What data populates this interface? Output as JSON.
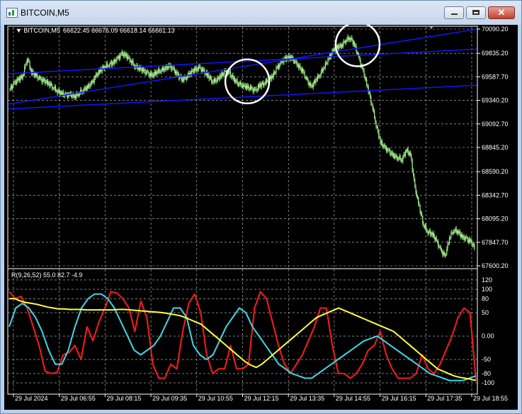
{
  "window": {
    "title": "BITCOIN,M5",
    "minimize_icon": "minimize-icon",
    "maximize_icon": "maximize-icon",
    "close_icon": "close-icon",
    "close_glyph": "✕"
  },
  "colors": {
    "background": "#000000",
    "grid": "#c8c8c8",
    "candles": "#a6f08c",
    "channel": "#1414ff",
    "highlight": "#ffffff",
    "osc_red": "#ff1a1a",
    "osc_cyan": "#3cd8e8",
    "osc_yellow": "#ffff33",
    "text": "#ffffff"
  },
  "chart_data": [
    {
      "type": "candlestick",
      "symbol_label": "BITCOIN,M5",
      "ohlc_label": "66622.45 66676.09 66618.14 66661.13",
      "y_ticks": [
        "70090.20",
        "69835.20",
        "69587.70",
        "69340.20",
        "69092.70",
        "68845.20",
        "68590.20",
        "68342.70",
        "68095.20",
        "67847.70",
        "67600.20"
      ],
      "ylim": [
        67600.2,
        70090.2
      ],
      "x_ticks": [
        "29 Jul 2024",
        "29 Jul 06:55",
        "29 Jul 08:15",
        "29 Jul 09:35",
        "29 Jul 10:55",
        "29 Jul 12:15",
        "29 Jul 13:35",
        "29 Jul 14:55",
        "29 Jul 16:15",
        "29 Jul 17:35",
        "29 Jul 18:55"
      ],
      "series": [
        {
          "values": [
            69460,
            69520,
            69560,
            69600,
            69790,
            69640,
            69600,
            69560,
            69540,
            69520,
            69480,
            69440,
            69410,
            69390,
            69400,
            69380,
            69420,
            69450,
            69480,
            69520,
            69600,
            69660,
            69700,
            69720,
            69740,
            69780,
            69830,
            69810,
            69760,
            69700,
            69680,
            69650,
            69620,
            69600,
            69640,
            69660,
            69680,
            69700,
            69660,
            69600,
            69560,
            69590,
            69640,
            69660,
            69680,
            69640,
            69600,
            69540,
            69560,
            69600,
            69640,
            69620,
            69560,
            69520,
            69500,
            69480,
            69460,
            69440,
            69500,
            69520,
            69560,
            69600,
            69680,
            69740,
            69780,
            69800,
            69760,
            69700,
            69640,
            69540,
            69480,
            69560,
            69620,
            69700,
            69780,
            69860,
            69900,
            69920,
            69980,
            70000,
            69920,
            69780,
            69640,
            69480,
            69300,
            69080,
            68900,
            68840,
            68800,
            68760,
            68740,
            68720,
            68820,
            68760,
            68420,
            68220,
            68030,
            67960,
            67940,
            67860,
            67760,
            67700,
            67900,
            67980,
            67960,
            67900,
            67880,
            67850,
            67780
          ]
        }
      ],
      "channel_lines": [
        {
          "from": [
            0,
            69300
          ],
          "to": [
            1,
            70090
          ]
        },
        {
          "from": [
            0,
            69620
          ],
          "to": [
            1,
            69880
          ]
        },
        {
          "from": [
            0,
            69250
          ],
          "to": [
            1,
            69500
          ]
        }
      ],
      "highlight_circles": [
        {
          "t": 0.51,
          "value": 69540
        },
        {
          "t": 0.745,
          "value": 69930
        }
      ]
    },
    {
      "type": "line",
      "label": "R(9,26,52) 55.0 82.7 -4.9",
      "y_ticks": [
        "120",
        "100",
        "80",
        "50",
        "0.00",
        "-50",
        "-80",
        "-100"
      ],
      "y_tick_values": [
        120,
        100,
        80,
        50,
        0,
        -50,
        -80,
        -100
      ],
      "ylim": [
        -115,
        135
      ],
      "series": [
        {
          "color": "osc_red",
          "values": [
            95,
            80,
            85,
            60,
            20,
            -20,
            -75,
            -80,
            -78,
            -40,
            -35,
            -20,
            -50,
            20,
            -10,
            30,
            60,
            95,
            92,
            80,
            60,
            10,
            75,
            40,
            -60,
            -90,
            -90,
            -60,
            -70,
            10,
            70,
            90,
            50,
            -40,
            -80,
            -70,
            -70,
            -20,
            -70,
            -70,
            -60,
            60,
            95,
            80,
            30,
            -20,
            -60,
            -80,
            -60,
            -40,
            -10,
            20,
            60,
            60,
            -20,
            -80,
            -80,
            -90,
            -80,
            -60,
            -30,
            -20,
            10,
            -40,
            -70,
            -90,
            -90,
            -90,
            -80,
            -40,
            -70,
            -80,
            -60,
            -30,
            0,
            40,
            60,
            50,
            -95
          ]
        },
        {
          "color": "osc_cyan",
          "values": [
            20,
            60,
            70,
            60,
            40,
            10,
            -30,
            -60,
            -60,
            -30,
            20,
            60,
            80,
            90,
            90,
            80,
            60,
            30,
            0,
            -30,
            -40,
            -30,
            -20,
            0,
            30,
            60,
            60,
            40,
            -20,
            -40,
            -50,
            -40,
            -10,
            20,
            40,
            60,
            50,
            20,
            0,
            -20,
            -40,
            -60,
            -70,
            -80,
            -85,
            -90,
            -90,
            -80,
            -70,
            -60,
            -50,
            -40,
            -30,
            -20,
            -10,
            -5,
            0,
            -10,
            -20,
            -30,
            -40,
            -50,
            -60,
            -70,
            -80,
            -85,
            -90,
            -95,
            -95,
            -95,
            -90,
            -85
          ]
        },
        {
          "color": "osc_yellow",
          "values": [
            80,
            80,
            75,
            72,
            70,
            68,
            65,
            62,
            60,
            58,
            58,
            57,
            57,
            57,
            56,
            56,
            56,
            56,
            56,
            56,
            57,
            57,
            56,
            55,
            54,
            53,
            52,
            51,
            50,
            48,
            46,
            44,
            40,
            35,
            30,
            25,
            15,
            5,
            -5,
            -15,
            -25,
            -35,
            -45,
            -55,
            -62,
            -67,
            -60,
            -50,
            -40,
            -30,
            -20,
            -10,
            0,
            10,
            20,
            30,
            40,
            45,
            50,
            55,
            60,
            55,
            50,
            45,
            40,
            35,
            30,
            25,
            20,
            15,
            10,
            0,
            -10,
            -20,
            -30,
            -40,
            -50,
            -60,
            -70,
            -75,
            -80,
            -85,
            -88,
            -90,
            -92,
            -95
          ]
        }
      ]
    }
  ]
}
